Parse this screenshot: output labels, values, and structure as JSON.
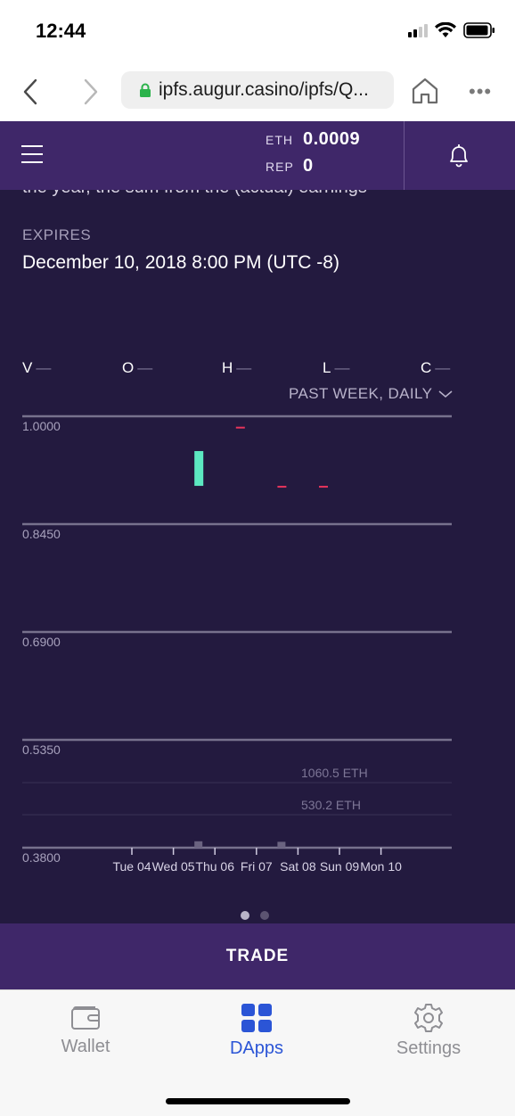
{
  "status_bar": {
    "time": "12:44"
  },
  "browser": {
    "url": "ipfs.augur.casino/ipfs/Q..."
  },
  "header": {
    "eth_label": "ETH",
    "eth_value": "0.0009",
    "rep_label": "REP",
    "rep_value": "0"
  },
  "market": {
    "cut_text": "the year, the sum from the (actual) earnings",
    "expires_label": "EXPIRES",
    "expires_value": "December 10, 2018 8:00 PM (UTC -8)"
  },
  "ohlc": [
    {
      "label": "V",
      "value": "—"
    },
    {
      "label": "O",
      "value": "—"
    },
    {
      "label": "H",
      "value": "—"
    },
    {
      "label": "L",
      "value": "—"
    },
    {
      "label": "C",
      "value": "—"
    }
  ],
  "range_selector": {
    "label": "PAST WEEK, DAILY"
  },
  "chart_data": {
    "type": "candlestick",
    "y_ticks": [
      "1.0000",
      "0.8450",
      "0.6900",
      "0.5350",
      "0.3800"
    ],
    "ylim": [
      0.38,
      1.0
    ],
    "volume_ticks": [
      "1060.5 ETH",
      "530.2 ETH"
    ],
    "x_labels": [
      "Tue 04",
      "Wed 05",
      "Thu 06",
      "Fri 07",
      "Sat 08",
      "Sun 09",
      "Mon 10"
    ],
    "candles": [
      {
        "day": "Thu 06",
        "open": 0.9,
        "close": 0.95,
        "color": "#5ce8c1",
        "volume": 60
      },
      {
        "day": "Fri 07",
        "open": 0.985,
        "close": 0.985,
        "color": "#e6345c",
        "volume": 0
      },
      {
        "day": "Sat 08",
        "open": 0.9,
        "close": 0.9,
        "color": "#e6345c",
        "volume": 55
      },
      {
        "day": "Sun 09",
        "open": 0.9,
        "close": 0.9,
        "color": "#e6345c",
        "volume": 0
      }
    ]
  },
  "pager": {
    "pages": 2,
    "active": 0
  },
  "trade_button": {
    "label": "TRADE"
  },
  "tab_bar": {
    "tabs": [
      {
        "label": "Wallet",
        "active": false
      },
      {
        "label": "DApps",
        "active": true
      },
      {
        "label": "Settings",
        "active": false
      }
    ],
    "active_color": "#2b55d6",
    "inactive_color": "#8e8e93"
  }
}
